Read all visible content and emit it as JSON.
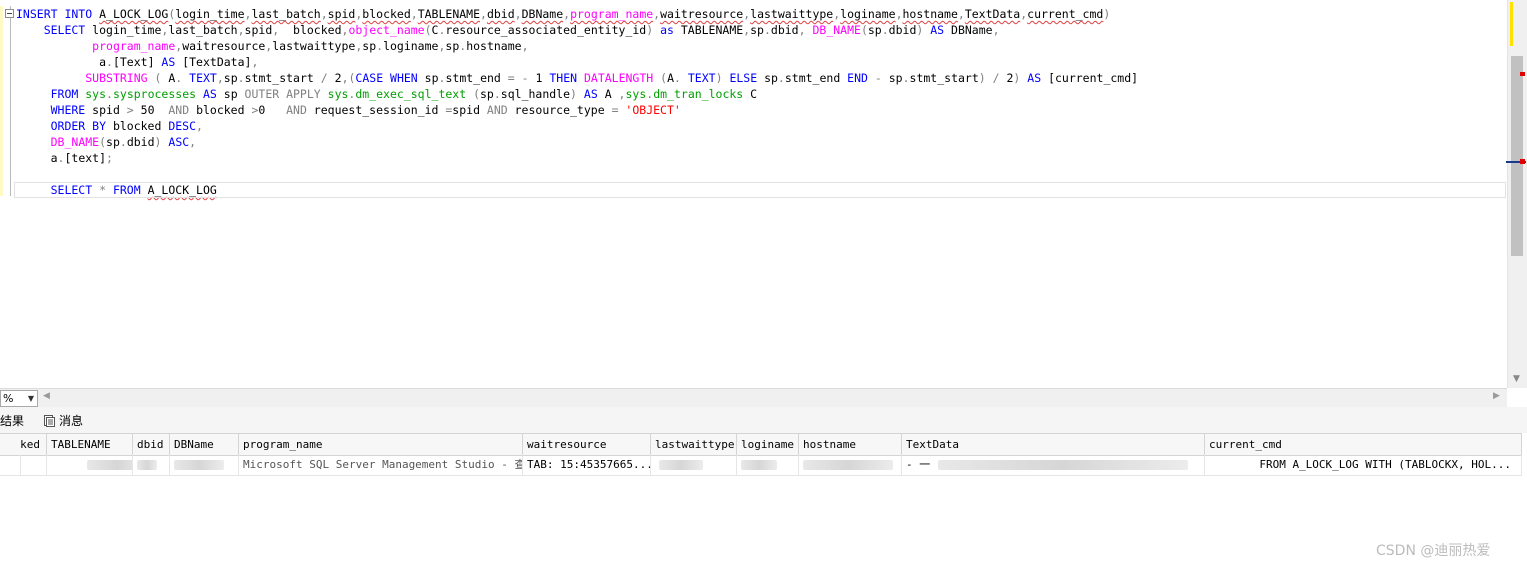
{
  "editor": {
    "lines": [
      {
        "tokens": [
          {
            "t": "INSERT INTO ",
            "c": "kw"
          },
          {
            "t": "A_LOCK_LOG",
            "c": "sq"
          },
          {
            "t": "(",
            "c": "gr"
          },
          {
            "t": "login_time",
            "c": "sq"
          },
          {
            "t": ",",
            "c": "gr"
          },
          {
            "t": "last_batch",
            "c": "sq"
          },
          {
            "t": ",",
            "c": "gr"
          },
          {
            "t": "spid",
            "c": "sq"
          },
          {
            "t": ",",
            "c": "gr"
          },
          {
            "t": "blocked",
            "c": "sq"
          },
          {
            "t": ",",
            "c": "gr"
          },
          {
            "t": "TABLENAME",
            "c": "sq"
          },
          {
            "t": ",",
            "c": "gr"
          },
          {
            "t": "dbid",
            "c": "sq"
          },
          {
            "t": ",",
            "c": "gr"
          },
          {
            "t": "DBName",
            "c": "sq"
          },
          {
            "t": ",",
            "c": "gr"
          },
          {
            "t": "program_name",
            "c": "fn sq"
          },
          {
            "t": ",",
            "c": "gr"
          },
          {
            "t": "waitresource",
            "c": "sq"
          },
          {
            "t": ",",
            "c": "gr"
          },
          {
            "t": "lastwaittype",
            "c": "sq"
          },
          {
            "t": ",",
            "c": "gr"
          },
          {
            "t": "loginame",
            "c": "sq"
          },
          {
            "t": ",",
            "c": "gr"
          },
          {
            "t": "hostname",
            "c": "sq"
          },
          {
            "t": ",",
            "c": "gr"
          },
          {
            "t": "TextData",
            "c": "sq"
          },
          {
            "t": ",",
            "c": "gr"
          },
          {
            "t": "current_cmd",
            "c": "sq"
          },
          {
            "t": ")",
            "c": "gr"
          }
        ]
      },
      {
        "tokens": [
          {
            "t": "    SELECT ",
            "c": "kw"
          },
          {
            "t": "login_time",
            "c": ""
          },
          {
            "t": ",",
            "c": "gr"
          },
          {
            "t": "last_batch",
            "c": ""
          },
          {
            "t": ",",
            "c": "gr"
          },
          {
            "t": "spid",
            "c": ""
          },
          {
            "t": ",  ",
            "c": "gr"
          },
          {
            "t": "blocked",
            "c": ""
          },
          {
            "t": ",",
            "c": "gr"
          },
          {
            "t": "object_name",
            "c": "fn"
          },
          {
            "t": "(",
            "c": "gr"
          },
          {
            "t": "C",
            "c": ""
          },
          {
            "t": ".",
            "c": "gr"
          },
          {
            "t": "resource_associated_entity_id",
            "c": ""
          },
          {
            "t": ") ",
            "c": "gr"
          },
          {
            "t": "as ",
            "c": "kw"
          },
          {
            "t": "TABLENAME",
            "c": ""
          },
          {
            "t": ",",
            "c": "gr"
          },
          {
            "t": "sp",
            "c": ""
          },
          {
            "t": ".",
            "c": "gr"
          },
          {
            "t": "dbid",
            "c": ""
          },
          {
            "t": ", ",
            "c": "gr"
          },
          {
            "t": "DB_NAME",
            "c": "fn"
          },
          {
            "t": "(",
            "c": "gr"
          },
          {
            "t": "sp",
            "c": ""
          },
          {
            "t": ".",
            "c": "gr"
          },
          {
            "t": "dbid",
            "c": ""
          },
          {
            "t": ") ",
            "c": "gr"
          },
          {
            "t": "AS ",
            "c": "kw"
          },
          {
            "t": "DBName",
            "c": ""
          },
          {
            "t": ",",
            "c": "gr"
          }
        ]
      },
      {
        "tokens": [
          {
            "t": "           ",
            "c": ""
          },
          {
            "t": "program_name",
            "c": "fn"
          },
          {
            "t": ",",
            "c": "gr"
          },
          {
            "t": "waitresource",
            "c": ""
          },
          {
            "t": ",",
            "c": "gr"
          },
          {
            "t": "lastwaittype",
            "c": ""
          },
          {
            "t": ",",
            "c": "gr"
          },
          {
            "t": "sp",
            "c": ""
          },
          {
            "t": ".",
            "c": "gr"
          },
          {
            "t": "loginame",
            "c": ""
          },
          {
            "t": ",",
            "c": "gr"
          },
          {
            "t": "sp",
            "c": ""
          },
          {
            "t": ".",
            "c": "gr"
          },
          {
            "t": "hostname",
            "c": ""
          },
          {
            "t": ",",
            "c": "gr"
          }
        ]
      },
      {
        "tokens": [
          {
            "t": "            a",
            "c": ""
          },
          {
            "t": ".",
            "c": "gr"
          },
          {
            "t": "[Text] ",
            "c": ""
          },
          {
            "t": "AS ",
            "c": "kw"
          },
          {
            "t": "[TextData]",
            "c": ""
          },
          {
            "t": ",",
            "c": "gr"
          }
        ]
      },
      {
        "tokens": [
          {
            "t": "          ",
            "c": ""
          },
          {
            "t": "SUBSTRING ",
            "c": "fn"
          },
          {
            "t": "( ",
            "c": "gr"
          },
          {
            "t": "A",
            "c": ""
          },
          {
            "t": ". ",
            "c": "gr"
          },
          {
            "t": "TEXT",
            "c": "kw"
          },
          {
            "t": ",",
            "c": "gr"
          },
          {
            "t": "sp",
            "c": ""
          },
          {
            "t": ".",
            "c": "gr"
          },
          {
            "t": "stmt_start ",
            "c": ""
          },
          {
            "t": "/ ",
            "c": "gr"
          },
          {
            "t": "2",
            "c": ""
          },
          {
            "t": ",(",
            "c": "gr"
          },
          {
            "t": "CASE WHEN ",
            "c": "kw"
          },
          {
            "t": "sp",
            "c": ""
          },
          {
            "t": ".",
            "c": "gr"
          },
          {
            "t": "stmt_end ",
            "c": ""
          },
          {
            "t": "= - ",
            "c": "gr"
          },
          {
            "t": "1 ",
            "c": ""
          },
          {
            "t": "THEN ",
            "c": "kw"
          },
          {
            "t": "DATALENGTH ",
            "c": "fn"
          },
          {
            "t": "(",
            "c": "gr"
          },
          {
            "t": "A",
            "c": ""
          },
          {
            "t": ". ",
            "c": "gr"
          },
          {
            "t": "TEXT",
            "c": "kw"
          },
          {
            "t": ") ",
            "c": "gr"
          },
          {
            "t": "ELSE ",
            "c": "kw"
          },
          {
            "t": "sp",
            "c": ""
          },
          {
            "t": ".",
            "c": "gr"
          },
          {
            "t": "stmt_end ",
            "c": ""
          },
          {
            "t": "END ",
            "c": "kw"
          },
          {
            "t": "- ",
            "c": "gr"
          },
          {
            "t": "sp",
            "c": ""
          },
          {
            "t": ".",
            "c": "gr"
          },
          {
            "t": "stmt_start",
            "c": ""
          },
          {
            "t": ") / ",
            "c": "gr"
          },
          {
            "t": "2",
            "c": ""
          },
          {
            "t": ") ",
            "c": "gr"
          },
          {
            "t": "AS ",
            "c": "kw"
          },
          {
            "t": "[current_cmd]",
            "c": ""
          }
        ]
      },
      {
        "tokens": [
          {
            "t": "     FROM ",
            "c": "kw"
          },
          {
            "t": "sys",
            "c": "sys"
          },
          {
            "t": ".",
            "c": "gr"
          },
          {
            "t": "sysprocesses ",
            "c": "sys"
          },
          {
            "t": "AS ",
            "c": "kw"
          },
          {
            "t": "sp ",
            "c": ""
          },
          {
            "t": "OUTER APPLY ",
            "c": "gr"
          },
          {
            "t": "sys",
            "c": "sys"
          },
          {
            "t": ".",
            "c": "gr"
          },
          {
            "t": "dm_exec_sql_text ",
            "c": "sys"
          },
          {
            "t": "(",
            "c": "gr"
          },
          {
            "t": "sp",
            "c": ""
          },
          {
            "t": ".",
            "c": "gr"
          },
          {
            "t": "sql_handle",
            "c": ""
          },
          {
            "t": ") ",
            "c": "gr"
          },
          {
            "t": "AS ",
            "c": "kw"
          },
          {
            "t": "A ",
            "c": ""
          },
          {
            "t": ",",
            "c": "gr"
          },
          {
            "t": "sys",
            "c": "sys"
          },
          {
            "t": ".",
            "c": "gr"
          },
          {
            "t": "dm_tran_locks ",
            "c": "sys"
          },
          {
            "t": "C",
            "c": ""
          }
        ]
      },
      {
        "tokens": [
          {
            "t": "     WHERE ",
            "c": "kw"
          },
          {
            "t": "spid ",
            "c": ""
          },
          {
            "t": "> ",
            "c": "gr"
          },
          {
            "t": "50  ",
            "c": ""
          },
          {
            "t": "AND ",
            "c": "gr"
          },
          {
            "t": "blocked ",
            "c": ""
          },
          {
            "t": ">",
            "c": "gr"
          },
          {
            "t": "0   ",
            "c": ""
          },
          {
            "t": "AND ",
            "c": "gr"
          },
          {
            "t": "request_session_id ",
            "c": ""
          },
          {
            "t": "=",
            "c": "gr"
          },
          {
            "t": "spid ",
            "c": ""
          },
          {
            "t": "AND ",
            "c": "gr"
          },
          {
            "t": "resource_type ",
            "c": ""
          },
          {
            "t": "= ",
            "c": "gr"
          },
          {
            "t": "'OBJECT'",
            "c": "str"
          }
        ]
      },
      {
        "tokens": [
          {
            "t": "     ORDER BY ",
            "c": "kw"
          },
          {
            "t": "blocked ",
            "c": ""
          },
          {
            "t": "DESC",
            "c": "kw"
          },
          {
            "t": ",",
            "c": "gr"
          }
        ]
      },
      {
        "tokens": [
          {
            "t": "     ",
            "c": ""
          },
          {
            "t": "DB_NAME",
            "c": "fn"
          },
          {
            "t": "(",
            "c": "gr"
          },
          {
            "t": "sp",
            "c": ""
          },
          {
            "t": ".",
            "c": "gr"
          },
          {
            "t": "dbid",
            "c": ""
          },
          {
            "t": ") ",
            "c": "gr"
          },
          {
            "t": "ASC",
            "c": "kw"
          },
          {
            "t": ",",
            "c": "gr"
          }
        ]
      },
      {
        "tokens": [
          {
            "t": "     a",
            "c": ""
          },
          {
            "t": ".",
            "c": "gr"
          },
          {
            "t": "[text]",
            "c": ""
          },
          {
            "t": ";",
            "c": "gr"
          }
        ]
      },
      {
        "tokens": []
      },
      {
        "tokens": [
          {
            "t": "     SELECT ",
            "c": "kw"
          },
          {
            "t": "* ",
            "c": "gr"
          },
          {
            "t": "FROM ",
            "c": "kw"
          },
          {
            "t": "A_LOCK_LOG",
            "c": "sq"
          }
        ]
      }
    ]
  },
  "zoom": {
    "value": "%"
  },
  "tabs": {
    "results": "结果",
    "messages": "消息"
  },
  "grid": {
    "columns": [
      {
        "label": "ked"
      },
      {
        "label": "TABLENAME"
      },
      {
        "label": "dbid"
      },
      {
        "label": "DBName"
      },
      {
        "label": "program_name"
      },
      {
        "label": "waitresource"
      },
      {
        "label": "lastwaittype"
      },
      {
        "label": "loginame"
      },
      {
        "label": "hostname"
      },
      {
        "label": "TextData"
      },
      {
        "label": "current_cmd"
      }
    ],
    "row": {
      "program_name": "Microsoft SQL Server Management Studio - 查询",
      "waitresource": "TAB: 15:45357665...",
      "textdata": "- 一",
      "current_cmd": "FROM A_LOCK_LOG WITH (TABLOCKX, HOL..."
    }
  },
  "watermark": "CSDN @迪丽热爱"
}
